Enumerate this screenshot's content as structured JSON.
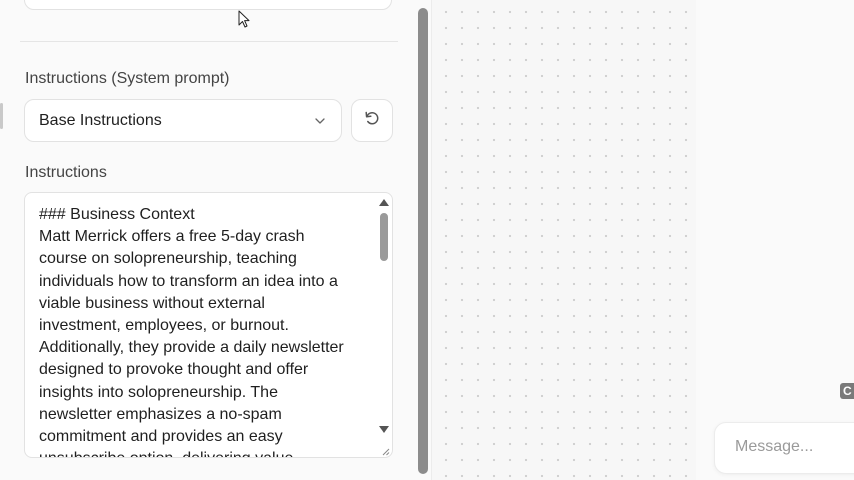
{
  "settings": {
    "instructions_section_label": "Instructions (System prompt)",
    "preset_select": {
      "selected": "Base Instructions"
    },
    "instructions_label": "Instructions",
    "instructions_text_lines": [
      "### Business Context",
      "Matt Merrick offers a free 5-day crash",
      "course on solopreneurship, teaching",
      "individuals how to transform an idea into a",
      "viable business without external",
      "investment, employees, or burnout.",
      "Additionally, they provide a daily newsletter",
      "designed to provoke thought and offer",
      "insights into solopreneurship. The",
      "newsletter emphasizes a no-spam",
      "commitment and provides an easy",
      "unsubscribe option, delivering value"
    ]
  },
  "chat": {
    "message_placeholder": "Message...",
    "badge_text": "C"
  },
  "icons": {
    "chevron": "chevron-down-icon",
    "reset": "reset-icon",
    "cursor": "mouse-pointer-icon",
    "resize": "resize-handle-icon"
  },
  "colors": {
    "background": "#fafafa",
    "border": "#e2e2e2",
    "scrollbar": "#8c8c8c",
    "canvas_dot": "#cfcfcf"
  }
}
